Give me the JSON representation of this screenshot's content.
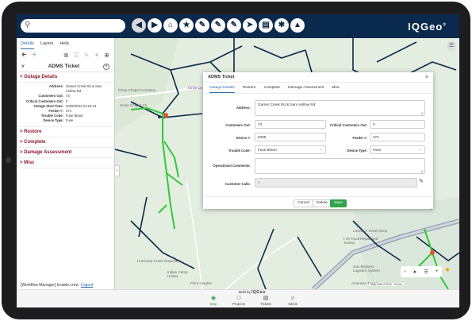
{
  "search": {
    "placeholder": ""
  },
  "toolbar": {
    "tools": [
      {
        "name": "back-tool",
        "glyph": "◀"
      },
      {
        "name": "forward-tool",
        "glyph": "▶"
      },
      {
        "name": "home-tool",
        "glyph": "⌂"
      },
      {
        "name": "star-tool",
        "glyph": "★"
      },
      {
        "name": "link-tool",
        "glyph": "✎"
      },
      {
        "name": "pencil-tool",
        "glyph": "✎"
      },
      {
        "name": "edit-tool",
        "glyph": "✎"
      },
      {
        "name": "navigate-tool",
        "glyph": "➤"
      },
      {
        "name": "print-tool",
        "glyph": "▤"
      },
      {
        "name": "network-tool",
        "glyph": "✱"
      },
      {
        "name": "terrain-tool",
        "glyph": "▲"
      }
    ]
  },
  "brand": {
    "logo": "IQGeo"
  },
  "left_panel": {
    "tabs": [
      "Details",
      "Layers",
      "Help"
    ],
    "title": "ADMS Ticket",
    "sections": {
      "outage": "Outage Details",
      "restore": "Restore",
      "complete": "Complete",
      "damage": "Damage Assessment",
      "misc": "Misc"
    },
    "details": [
      {
        "label": "Address:",
        "value": "Garner Creek Rd & Sam Hollow Rd"
      },
      {
        "label": "Customers Out:",
        "value": "73"
      },
      {
        "label": "Critical Customers Out:",
        "value": "0"
      },
      {
        "label": "Outage Start Time:",
        "value": "2025/02/10 21:04:14"
      },
      {
        "label": "Feeder #:",
        "value": "274"
      },
      {
        "label": "Trouble Code:",
        "value": "Fuse Blown"
      },
      {
        "label": "Device Type:",
        "value": "Fuse"
      }
    ],
    "status_text": "[Workflow Manager] trouble.crew",
    "logout": "Logout"
  },
  "map_labels": [
    "Piney Chapel Cemetery",
    "Circle Drive",
    "Union Chapel Ch",
    "Lovelace Travel Shop",
    "I-40 Truck Repair and Towing",
    "Hurricane Creek Disposal",
    "Indian Camp Hollow",
    "Price Heights",
    "Gas Midwest Logistics System",
    "American Tower"
  ],
  "map_attribution": "Map data ©2025 · Terms",
  "dialog": {
    "title": "ADMS Ticket",
    "tabs": [
      "Outage Details",
      "Restore",
      "Complete",
      "Damage Assessment",
      "Misc"
    ],
    "fields": {
      "address_label": "Address:",
      "address_value": "Garner Creek Rd & Sam Hollow Rd",
      "customers_out_label": "Customers Out:",
      "customers_out_value": "73",
      "critical_label": "Critical Customers Out:",
      "critical_value": "0",
      "device_label": "Device #:",
      "device_value": "6309",
      "feeder_label": "Feeder #:",
      "feeder_value": "274",
      "trouble_label": "Trouble Code:",
      "trouble_value": "Fuse Blown",
      "device_type_label": "Device Type:",
      "device_type_value": "Fuse",
      "operational_label": "Operational Comments:",
      "operational_value": "",
      "customer_calls_label": "Customer Calls:",
      "customer_calls_value": "0"
    },
    "buttons": {
      "cancel": "Cancel",
      "delete": "Delete",
      "save": "Save"
    }
  },
  "footer": {
    "built_by": "Built by",
    "built_brand": "IQGeo",
    "nav": [
      {
        "label": "Map",
        "icon": "pin-icon"
      },
      {
        "label": "Projects",
        "icon": "document-icon"
      },
      {
        "label": "Tickets",
        "icon": "ticket-icon"
      },
      {
        "label": "Admin",
        "icon": "person-icon"
      }
    ]
  },
  "colors": {
    "header": "#0a2a4d",
    "accent_green": "#2fa34a",
    "link_blue": "#2a6bb0",
    "section_red": "#8a1a2a"
  }
}
